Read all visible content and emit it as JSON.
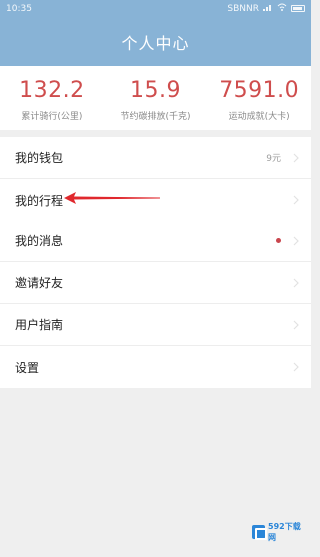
{
  "status_bar": {
    "time": "10:35",
    "network_text": "SBNNR"
  },
  "header": {
    "title": "个人中心"
  },
  "stats": [
    {
      "value": "132.2",
      "label": "累计骑行(公里)"
    },
    {
      "value": "15.9",
      "label": "节约碳排放(千克)"
    },
    {
      "value": "7591.0",
      "label": "运动成就(大卡)"
    }
  ],
  "menu_group_1": [
    {
      "label": "我的钱包",
      "extra": "9元"
    },
    {
      "label": "我的行程"
    }
  ],
  "menu_group_2": [
    {
      "label": "我的消息",
      "badge": true
    },
    {
      "label": "邀请好友"
    },
    {
      "label": "用户指南"
    },
    {
      "label": "设置"
    }
  ],
  "watermark": {
    "text": "592下载网"
  },
  "colors": {
    "header_bg": "#88b3d6",
    "stat_value": "#cf4d4d",
    "badge": "#c9454d",
    "annotation_arrow": "#e0282d"
  },
  "icons": {
    "chevron": "chevron-right-icon",
    "badge": "red-dot-badge"
  }
}
